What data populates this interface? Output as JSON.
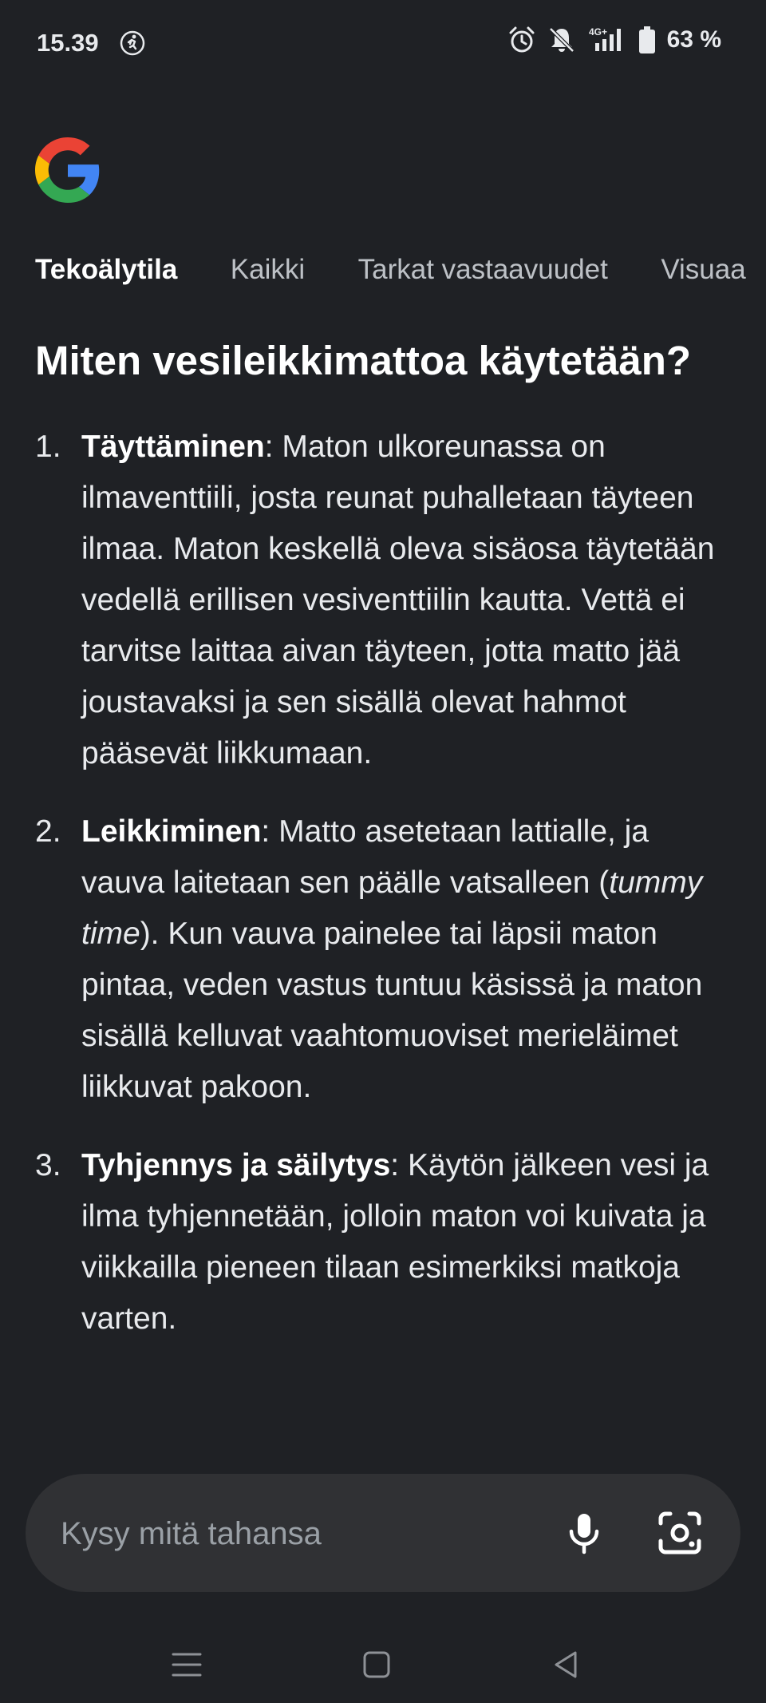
{
  "status_bar": {
    "time": "15.39",
    "network": "4G+",
    "battery": "63 %"
  },
  "tabs": [
    {
      "label": "Tekoälytila",
      "active": true
    },
    {
      "label": "Kaikki",
      "active": false
    },
    {
      "label": "Tarkat vastaavuudet",
      "active": false
    },
    {
      "label": "Visuaa",
      "active": false
    }
  ],
  "question": "Miten vesileikkimattoa käytetään?",
  "answers": [
    {
      "number": "1.",
      "title": "Täyttäminen",
      "text": ": Maton ulkoreunassa on ilmaventtiili, josta reunat puhalletaan täyteen ilmaa. Maton keskellä oleva sisäosa täytetään vedellä erillisen vesiventtiilin kautta. Vettä ei tarvitse laittaa aivan täyteen, jotta matto jää joustavaksi ja sen sisällä olevat hahmot pääsevät liikkumaan."
    },
    {
      "number": "2.",
      "title": "Leikkiminen",
      "text_before": ": Matto asetetaan lattialle, ja vauva laitetaan sen päälle vatsalleen (",
      "italic": "tummy time",
      "text_after": "). Kun vauva painelee tai läpsii maton pintaa, veden vastus tuntuu käsissä ja maton sisällä kelluvat vaahtomuoviset merieläimet liikkuvat pakoon."
    },
    {
      "number": "3.",
      "title": "Tyhjennys ja säilytys",
      "text": ": Käytön jälkeen vesi ja ilma tyhjennetään, jolloin maton voi kuivata ja viikkailla pieneen tilaan esimerkiksi matkoja varten."
    }
  ],
  "ask_bar": {
    "placeholder": "Kysy mitä tahansa",
    "mic_icon": "mic-icon",
    "lens_icon": "google-lens-icon"
  },
  "colors": {
    "background": "#1f2125",
    "ask_bar": "#303134",
    "text": "#e8eaed"
  }
}
